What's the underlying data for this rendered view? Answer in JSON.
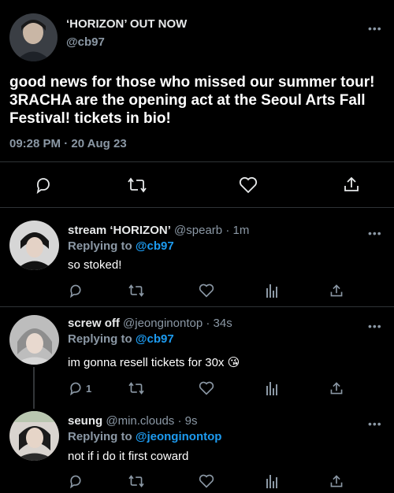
{
  "main_tweet": {
    "display_name": "‘HORIZON’ OUT NOW",
    "handle": "@cb97",
    "text": "good news for those who missed our summer tour! 3RACHA are the opening act at the Seoul Arts Fall Festival! tickets in bio!",
    "timestamp": "09:28 PM · 20 Aug 23"
  },
  "replies": [
    {
      "display_name": "stream ‘HORIZON’",
      "handle": "@spearb",
      "time": "· 1m",
      "replying_label": "Replying to",
      "replying_to": "@cb97",
      "text": "so stoked!",
      "reply_count": ""
    },
    {
      "display_name": "screw off",
      "handle": "@jeonginontop",
      "time": "· 34s",
      "replying_label": "Replying to",
      "replying_to": "@cb97",
      "text": "im gonna resell tickets for 30x 😘",
      "reply_count": "1"
    },
    {
      "display_name": "seung",
      "handle": "@min.clouds",
      "time": "· 9s",
      "replying_label": "Replying to",
      "replying_to": "@jeonginontop",
      "text": "not if i do it first coward",
      "reply_count": ""
    }
  ],
  "colors": {
    "background": "#000000",
    "text": "#e7e9ea",
    "muted": "#8b98a5",
    "link": "#1d9bf0",
    "divider": "#2f3336"
  },
  "icons": [
    "more-icon",
    "reply-icon",
    "retweet-icon",
    "like-icon",
    "stats-icon",
    "share-icon"
  ]
}
